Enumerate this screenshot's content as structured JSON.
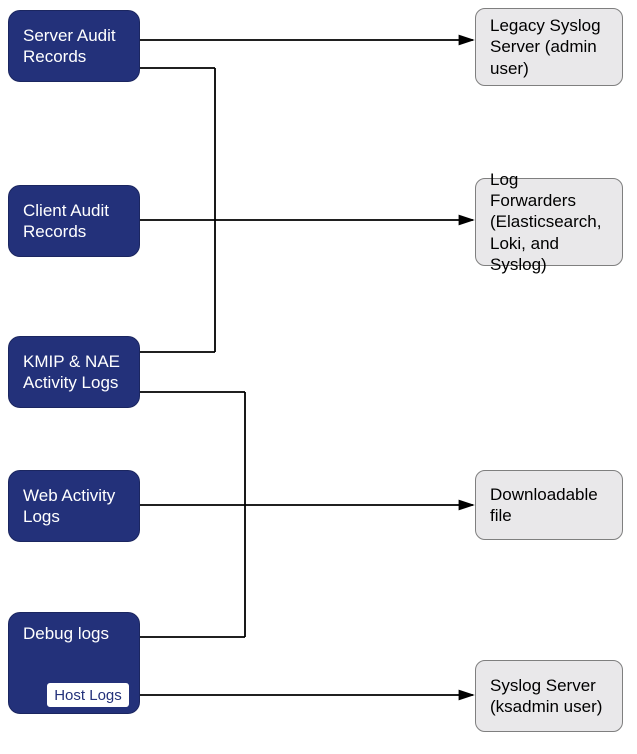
{
  "sources": {
    "server_audit": "Server Audit Records",
    "client_audit": "Client Audit Records",
    "kmip_nae": "KMIP & NAE Activity Logs",
    "web_activity": "Web Activity Logs",
    "debug": "Debug logs",
    "host_logs": "Host Logs"
  },
  "destinations": {
    "legacy_syslog": "Legacy Syslog Server (admin user)",
    "log_forwarders": "Log Forwarders (Elasticsearch, Loki, and Syslog)",
    "downloadable_file": "Downloadable file",
    "syslog_server": "Syslog Server (ksadmin user)"
  },
  "colors": {
    "source_bg": "#23317a",
    "source_text": "#ffffff",
    "dest_bg": "#e9e8ea",
    "dest_border": "#7f7f7f",
    "line": "#000000"
  },
  "chart_data": {
    "type": "diagram",
    "nodes": [
      {
        "id": "server_audit",
        "kind": "source",
        "label": "Server Audit Records"
      },
      {
        "id": "client_audit",
        "kind": "source",
        "label": "Client Audit Records"
      },
      {
        "id": "kmip_nae",
        "kind": "source",
        "label": "KMIP & NAE Activity Logs"
      },
      {
        "id": "web_activity",
        "kind": "source",
        "label": "Web Activity Logs"
      },
      {
        "id": "debug",
        "kind": "source",
        "label": "Debug logs"
      },
      {
        "id": "host_logs",
        "kind": "source-sub",
        "parent": "debug",
        "label": "Host Logs"
      },
      {
        "id": "legacy_syslog",
        "kind": "dest",
        "label": "Legacy Syslog Server (admin user)"
      },
      {
        "id": "log_forwarders",
        "kind": "dest",
        "label": "Log Forwarders (Elasticsearch, Loki, and Syslog)"
      },
      {
        "id": "downloadable_file",
        "kind": "dest",
        "label": "Downloadable file"
      },
      {
        "id": "syslog_server",
        "kind": "dest",
        "label": "Syslog Server (ksadmin user)"
      }
    ],
    "edges": [
      {
        "from": "server_audit",
        "to": "legacy_syslog"
      },
      {
        "from": "server_audit",
        "to": "log_forwarders"
      },
      {
        "from": "client_audit",
        "to": "log_forwarders"
      },
      {
        "from": "kmip_nae",
        "to": "log_forwarders"
      },
      {
        "from": "kmip_nae",
        "to": "downloadable_file"
      },
      {
        "from": "web_activity",
        "to": "downloadable_file"
      },
      {
        "from": "debug",
        "to": "downloadable_file"
      },
      {
        "from": "host_logs",
        "to": "syslog_server"
      }
    ]
  }
}
